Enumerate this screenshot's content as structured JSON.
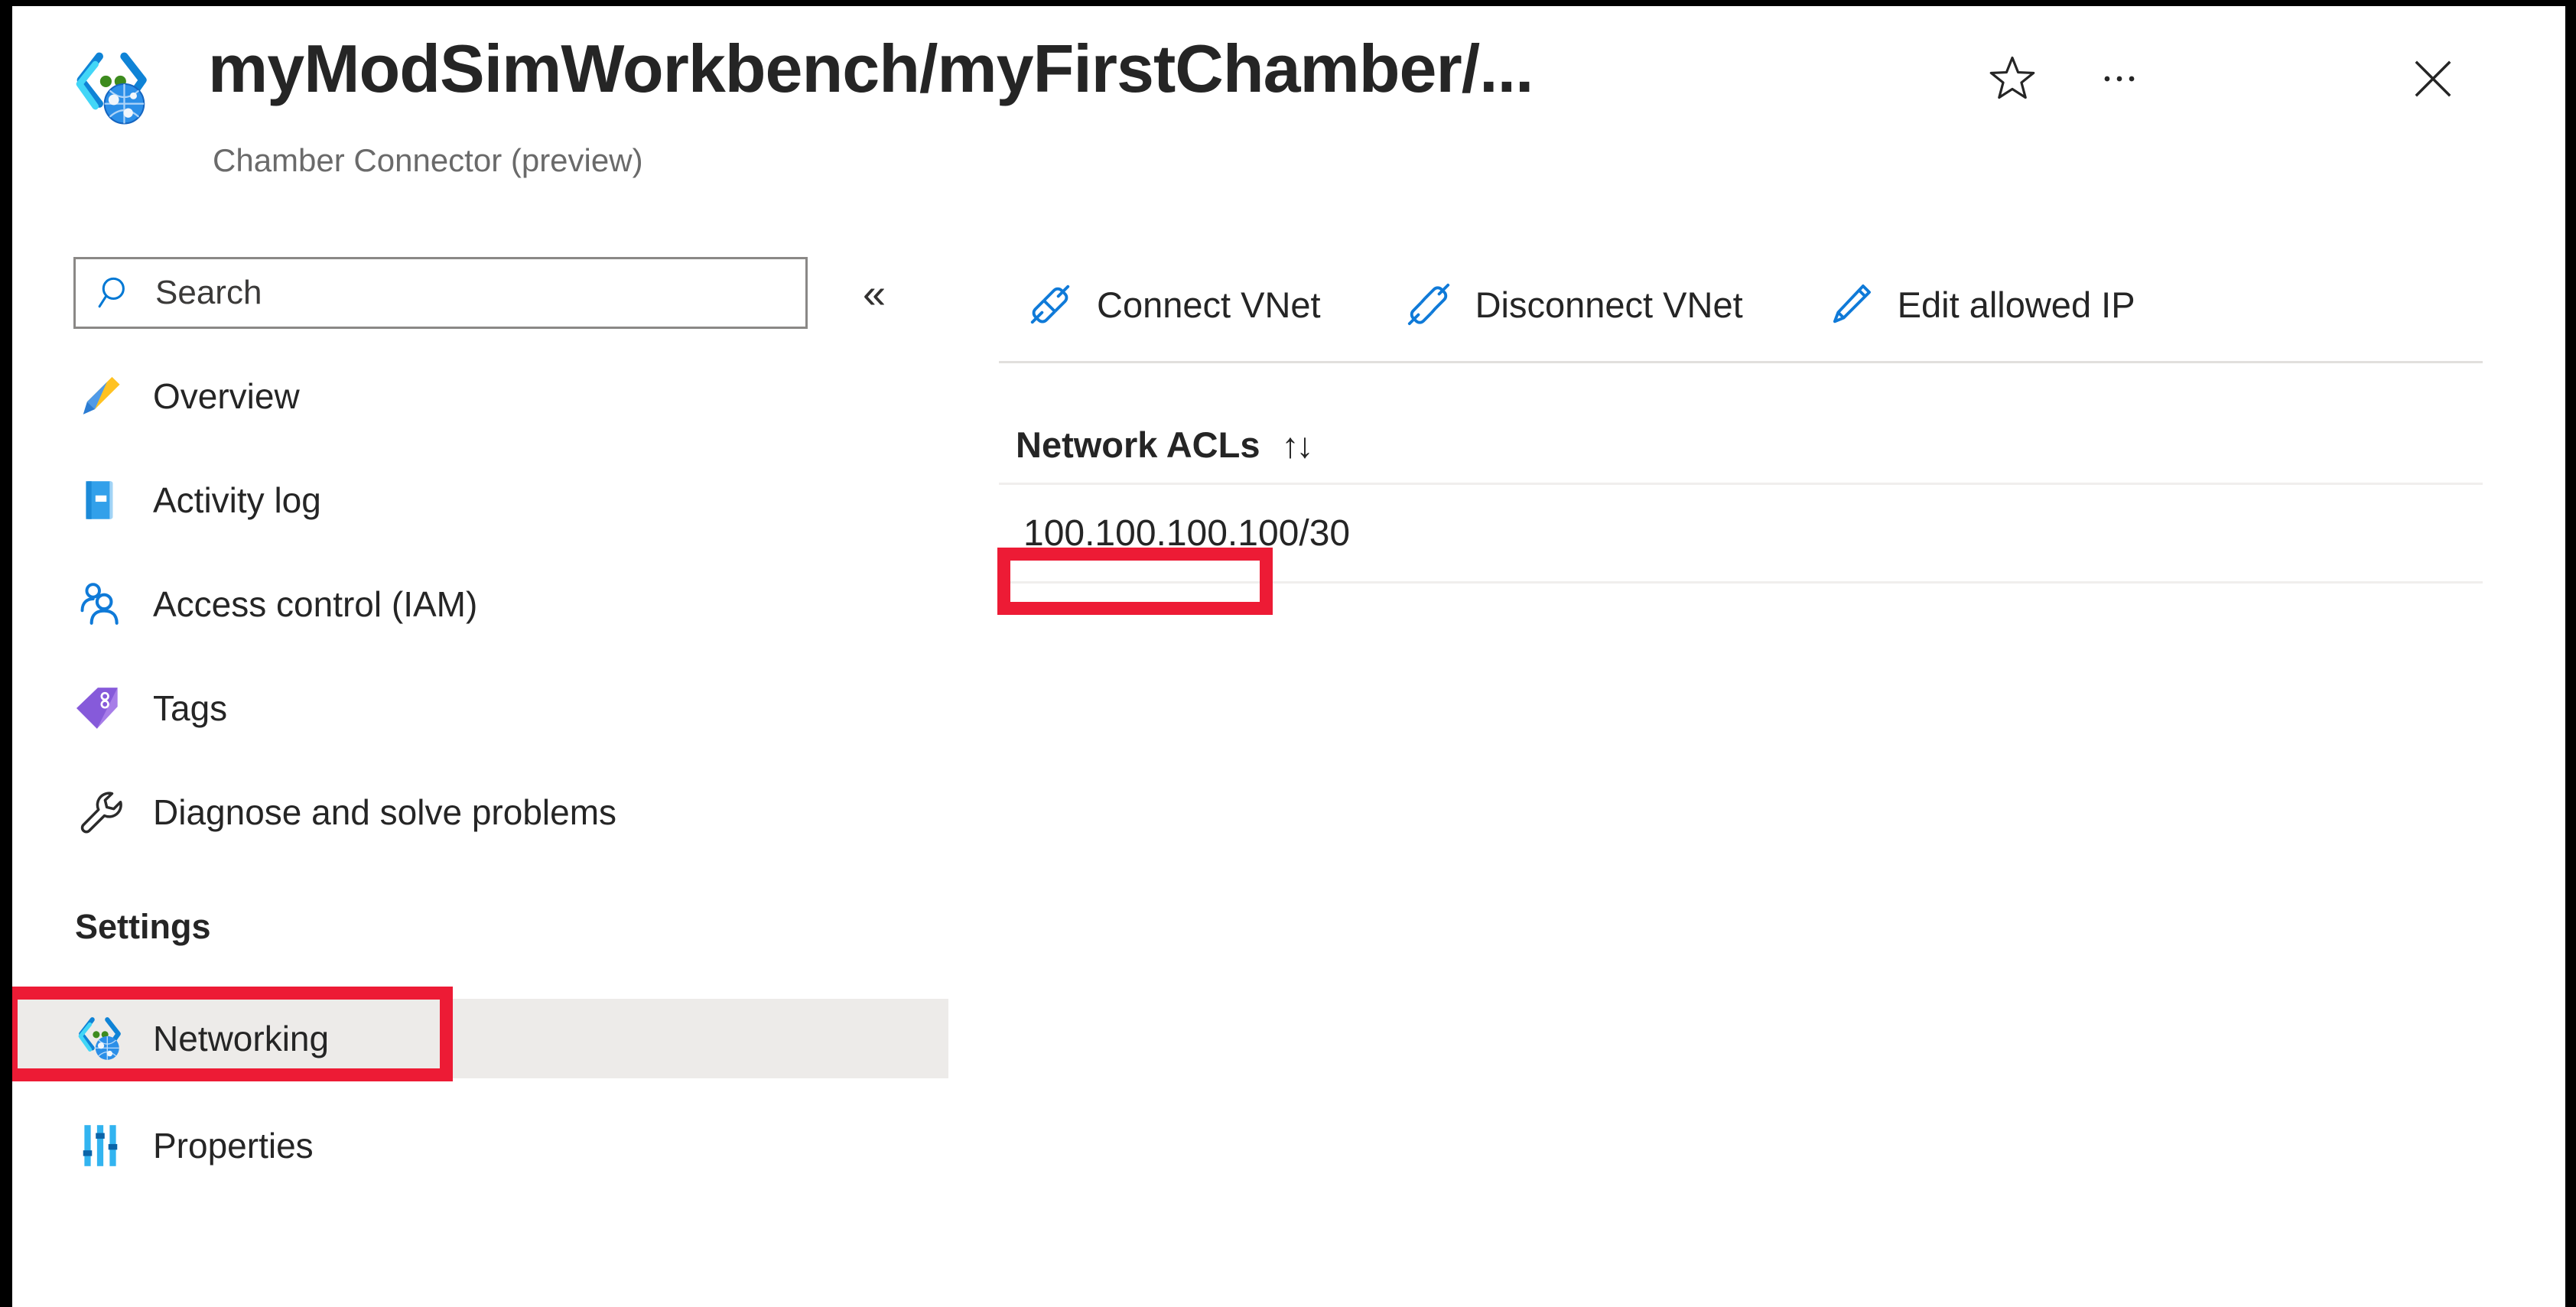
{
  "header": {
    "resource_icon": "chamber-connector-icon",
    "title": "myModSimWorkbench/myFirstChamber/...",
    "subtitle": "Chamber Connector (preview)",
    "favorite_icon": "star-icon",
    "more_icon": "ellipsis-icon",
    "close_icon": "close-icon"
  },
  "sidebar": {
    "search": {
      "placeholder": "Search",
      "value": "",
      "icon": "search-icon"
    },
    "collapse_icon": "chevron-double-left-icon",
    "items": [
      {
        "label": "Overview",
        "icon": "overview-icon",
        "selected": false
      },
      {
        "label": "Activity log",
        "icon": "activity-log-icon",
        "selected": false
      },
      {
        "label": "Access control (IAM)",
        "icon": "people-icon",
        "selected": false
      },
      {
        "label": "Tags",
        "icon": "tag-icon",
        "selected": false
      },
      {
        "label": "Diagnose and solve problems",
        "icon": "wrench-icon",
        "selected": false
      }
    ],
    "section_label": "Settings",
    "settings_items": [
      {
        "label": "Networking",
        "icon": "networking-icon",
        "selected": true
      },
      {
        "label": "Properties",
        "icon": "properties-icon",
        "selected": false
      }
    ]
  },
  "toolbar": {
    "buttons": [
      {
        "label": "Connect VNet",
        "icon": "plug-connected-icon"
      },
      {
        "label": "Disconnect VNet",
        "icon": "plug-disconnected-icon"
      },
      {
        "label": "Edit allowed IP",
        "icon": "pencil-icon"
      }
    ]
  },
  "main": {
    "acl_section_title": "Network ACLs",
    "sort_icon": "sort-arrows-icon",
    "sort_glyph": "↑↓",
    "acl_rows": [
      {
        "value": "100.100.100.100/30"
      }
    ]
  },
  "annotations": {
    "color": "#ED1B35",
    "targets": [
      "sidebar-item-networking",
      "acl-row-value"
    ]
  }
}
